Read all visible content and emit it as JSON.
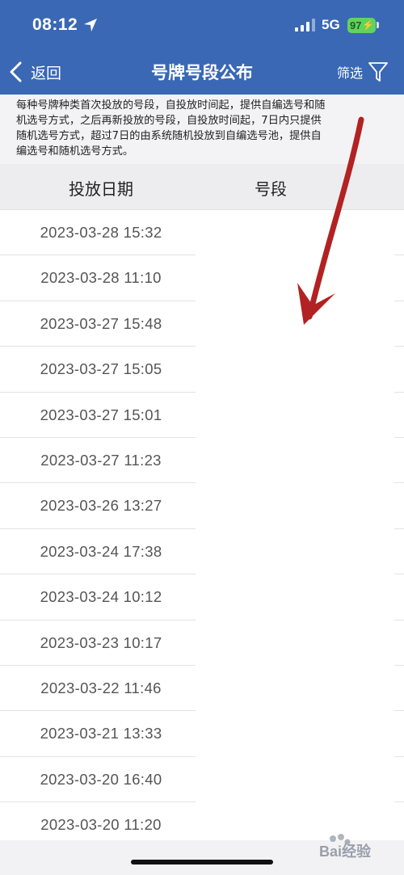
{
  "status_bar": {
    "time": "08:12",
    "network": "5G",
    "battery": "97"
  },
  "nav": {
    "back_label": "返回",
    "title": "号牌号段公布",
    "filter_label": "筛选"
  },
  "notice": {
    "lines": [
      "每种号牌种类首次投放的号段，自投放时间起，提供自编选号和随",
      "机选号方式，之后再新投放的号段，自投放时间起，7日内只提供",
      "随机选号方式，超过7日的由系统随机投放到自编选号池，提供自",
      "编选号和随机选号方式。"
    ]
  },
  "table": {
    "headers": {
      "date": "投放日期",
      "segment": "号段"
    },
    "rows": [
      {
        "date": "2023-03-28 15:32",
        "segment": ""
      },
      {
        "date": "2023-03-28 11:10",
        "segment": ""
      },
      {
        "date": "2023-03-27 15:48",
        "segment": ""
      },
      {
        "date": "2023-03-27 15:05",
        "segment": ""
      },
      {
        "date": "2023-03-27 15:01",
        "segment": ""
      },
      {
        "date": "2023-03-27 11:23",
        "segment": ""
      },
      {
        "date": "2023-03-26 13:27",
        "segment": ""
      },
      {
        "date": "2023-03-24 17:38",
        "segment": ""
      },
      {
        "date": "2023-03-24 10:12",
        "segment": ""
      },
      {
        "date": "2023-03-23 10:17",
        "segment": ""
      },
      {
        "date": "2023-03-22 11:46",
        "segment": ""
      },
      {
        "date": "2023-03-21 13:33",
        "segment": ""
      },
      {
        "date": "2023-03-20 16:40",
        "segment": ""
      },
      {
        "date": "2023-03-20 11:20",
        "segment": ""
      }
    ]
  },
  "overlay": {
    "arrow_color": "#b22222"
  },
  "watermark": {
    "text": "Bai经验"
  },
  "colors": {
    "header_blue": "#3a68b4",
    "battery_green": "#5fd35f"
  }
}
